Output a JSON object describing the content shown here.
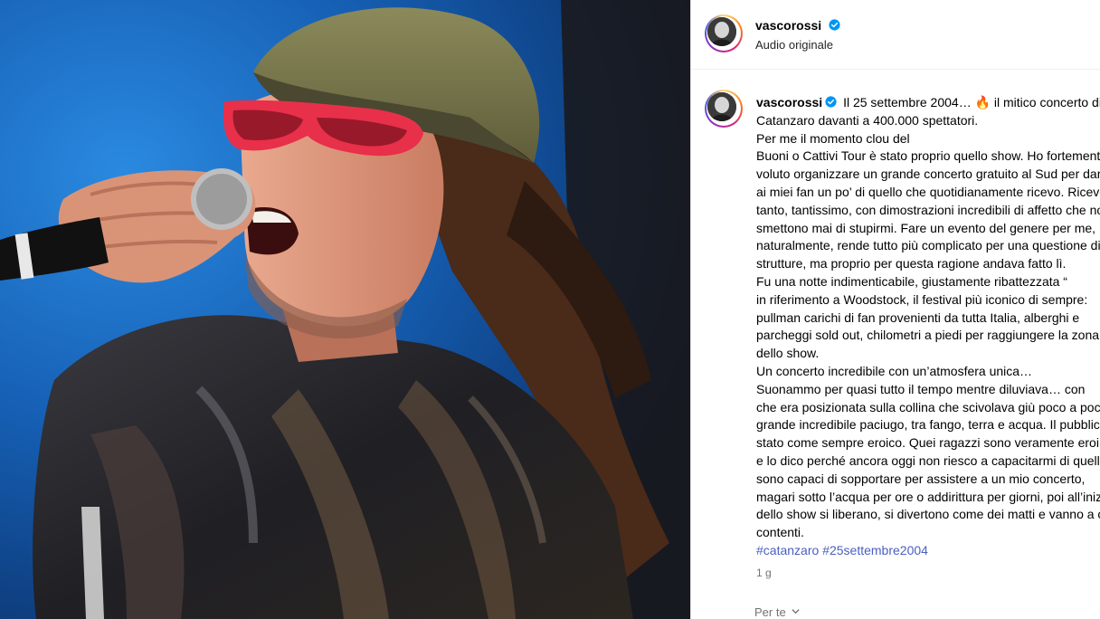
{
  "post": {
    "author": "vascorossi",
    "audio_label": "Audio originale",
    "caption_lines": [
      "Il 25 settembre 2004… 🔥 il mitico concerto di",
      "Catanzaro davanti a 400.000 spettatori.",
      "Per me il momento clou del",
      "Buoni o Cattivi Tour è stato proprio quello show. Ho fortemente",
      "voluto organizzare un grande concerto gratuito al Sud per dare",
      "ai miei fan un po’ di quello che quotidianamente ricevo. Ricevo",
      "tanto, tantissimo, con dimostrazioni incredibili di affetto che non",
      "smettono mai di stupirmi. Fare un evento del genere per me,",
      "naturalmente, rende tutto più complicato per una questione di",
      "strutture, ma proprio per questa ragione andava fatto lì.",
      "Fu una notte indimenticabile, giustamente ribattezzata “",
      "in riferimento a Woodstock, il festival più iconico di sempre:",
      "pullman carichi di fan provenienti da tutta Italia, alberghi e",
      "parcheggi sold out, chilometri a piedi per raggiungere la zona",
      "dello show.",
      "Un concerto incredibile con un’atmosfera unica…",
      "Suonammo per quasi tutto il tempo mentre diluviava… con",
      "che era posizionata sulla collina che scivolava giù poco a poco, un",
      "grande incredibile paciugo, tra fango, terra e acqua. Il pubblico è",
      "stato come sempre eroico. Quei ragazzi sono veramente eroi,",
      "e lo dico perché ancora oggi non riesco a capacitarmi di quello che",
      "sono capaci di sopportare per assistere a un mio concerto,",
      "magari sotto l’acqua per ore o addirittura per giorni, poi all’inizio",
      "dello show si liberano, si divertono come dei matti e vanno a casa",
      "contenti."
    ],
    "hashtags": [
      "#catanzaro",
      "#25settembre2004"
    ],
    "timestamp": "1 g",
    "for_you_label": "Per te"
  },
  "colors": {
    "verified": "#0095f6",
    "hashtag": "#4a5fc1",
    "muted": "#737373"
  }
}
